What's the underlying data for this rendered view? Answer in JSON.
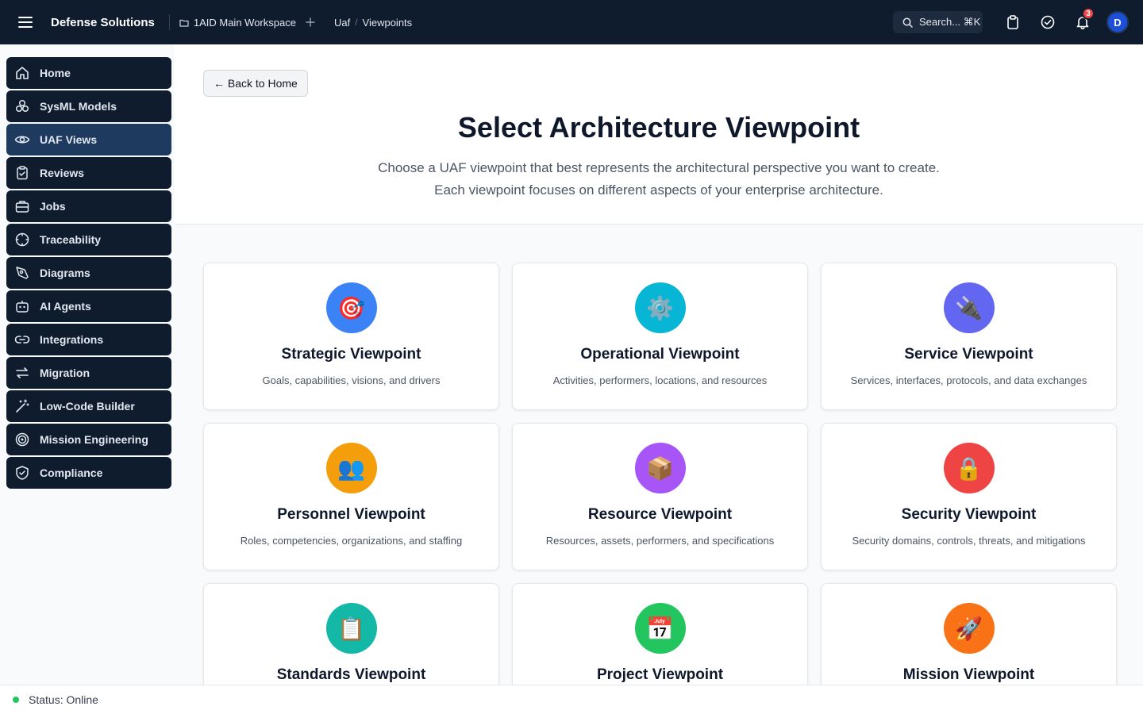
{
  "topbar": {
    "brand": "Defense Solutions",
    "workspace": "1AID Main Workspace",
    "breadcrumb": [
      "Uaf",
      "Viewpoints"
    ],
    "search_label": "Search... ⌘K",
    "notification_count": "3",
    "avatar_initial": "D"
  },
  "sidebar": {
    "items": [
      {
        "label": "Home",
        "icon": "home-icon"
      },
      {
        "label": "SysML Models",
        "icon": "cubes-icon"
      },
      {
        "label": "UAF Views",
        "icon": "eye-icon",
        "active": true
      },
      {
        "label": "Reviews",
        "icon": "clipboard-check-icon"
      },
      {
        "label": "Jobs",
        "icon": "briefcase-icon"
      },
      {
        "label": "Traceability",
        "icon": "crosshair-icon"
      },
      {
        "label": "Diagrams",
        "icon": "pen-tool-icon"
      },
      {
        "label": "AI Agents",
        "icon": "bot-icon"
      },
      {
        "label": "Integrations",
        "icon": "link-icon"
      },
      {
        "label": "Migration",
        "icon": "arrows-swap-icon"
      },
      {
        "label": "Low-Code Builder",
        "icon": "magic-wand-icon"
      },
      {
        "label": "Mission Engineering",
        "icon": "target-icon"
      },
      {
        "label": "Compliance",
        "icon": "shield-check-icon"
      }
    ]
  },
  "main": {
    "back_label": "← Back to Home",
    "title": "Select Architecture Viewpoint",
    "subtitle_line1": "Choose a UAF viewpoint that best represents the architectural perspective you want to create.",
    "subtitle_line2": "Each viewpoint focuses on different aspects of your enterprise architecture.",
    "cards": [
      {
        "title": "Strategic Viewpoint",
        "desc": "Goals, capabilities, visions, and drivers",
        "emoji": "🎯",
        "color": "#3b82f6"
      },
      {
        "title": "Operational Viewpoint",
        "desc": "Activities, performers, locations, and resources",
        "emoji": "⚙️",
        "color": "#06b6d4"
      },
      {
        "title": "Service Viewpoint",
        "desc": "Services, interfaces, protocols, and data exchanges",
        "emoji": "🔌",
        "color": "#6366f1"
      },
      {
        "title": "Personnel Viewpoint",
        "desc": "Roles, competencies, organizations, and staffing",
        "emoji": "👥",
        "color": "#f59e0b"
      },
      {
        "title": "Resource Viewpoint",
        "desc": "Resources, assets, performers, and specifications",
        "emoji": "📦",
        "color": "#a855f7"
      },
      {
        "title": "Security Viewpoint",
        "desc": "Security domains, controls, threats, and mitigations",
        "emoji": "🔒",
        "color": "#ef4444"
      },
      {
        "title": "Standards Viewpoint",
        "desc": "",
        "emoji": "📋",
        "color": "#14b8a6"
      },
      {
        "title": "Project Viewpoint",
        "desc": "",
        "emoji": "📅",
        "color": "#22c55e"
      },
      {
        "title": "Mission Viewpoint",
        "desc": "",
        "emoji": "🚀",
        "color": "#f97316"
      }
    ]
  },
  "status": {
    "label": "Status: Online",
    "color": "#22c55e"
  },
  "colors": {
    "topbar": "#0f1c2e",
    "sidebar_item": "#0f1c2e",
    "sidebar_active": "#1e3a5f",
    "badge": "#ef4444"
  }
}
